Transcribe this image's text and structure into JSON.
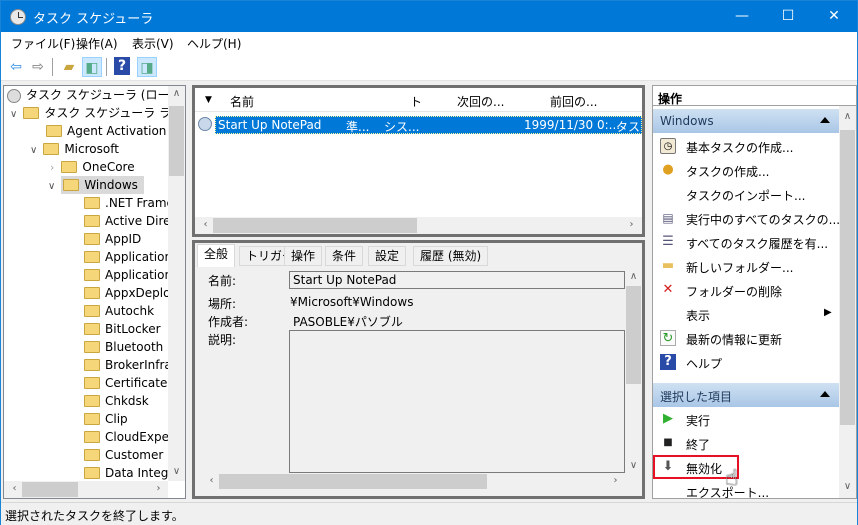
{
  "window": {
    "title": "タスク スケジューラ",
    "minimize": "—",
    "maximize": "☐",
    "close": "✕"
  },
  "menu": [
    "ファイル(F)",
    "操作(A)",
    "表示(V)",
    "ヘルプ(H)"
  ],
  "toolbar": {
    "icons": [
      "back-arrow-icon",
      "forward-arrow-icon",
      "up-folder-icon",
      "show-hide-console-tree-icon",
      "help-icon",
      "show-hide-action-pane-icon"
    ]
  },
  "tree": {
    "items": [
      {
        "label": "タスク スケジューラ (ローカル)",
        "level": 0,
        "chev": ""
      },
      {
        "label": "タスク スケジューラ ライブラリ",
        "level": 1,
        "chev": "∨"
      },
      {
        "label": "Agent Activation Runtime",
        "level": 2,
        "chev": ""
      },
      {
        "label": "Microsoft",
        "level": 2,
        "chev": "∨"
      },
      {
        "label": "OneCore",
        "level": 3,
        "chev": "›"
      },
      {
        "label": "Windows",
        "level": 3,
        "chev": "∨",
        "selected": true
      },
      {
        "label": ".NET Framework",
        "level": 4
      },
      {
        "label": "Active Directory",
        "level": 4
      },
      {
        "label": "AppID",
        "level": 4
      },
      {
        "label": "Application",
        "level": 4
      },
      {
        "label": "Application",
        "level": 4
      },
      {
        "label": "AppxDeployment",
        "level": 4
      },
      {
        "label": "Autochk",
        "level": 4
      },
      {
        "label": "BitLocker",
        "level": 4
      },
      {
        "label": "Bluetooth",
        "level": 4
      },
      {
        "label": "BrokerInfrastructure",
        "level": 4
      },
      {
        "label": "CertificateServices",
        "level": 4
      },
      {
        "label": "Chkdsk",
        "level": 4
      },
      {
        "label": "Clip",
        "level": 4
      },
      {
        "label": "CloudExperience",
        "level": 4
      },
      {
        "label": "Customer Experience",
        "level": 4
      },
      {
        "label": "Data Integrity",
        "level": 4
      }
    ]
  },
  "list": {
    "columns": [
      "名前",
      "ト",
      "次回の...",
      "前回の..."
    ],
    "rows": [
      {
        "name": "Start Up NotePad",
        "status": "準...",
        "trigger": "シス...",
        "last_run": "1999/11/30 0:...",
        "result": "タスク"
      }
    ]
  },
  "detail": {
    "tabs": [
      "全般",
      "トリガー",
      "操作",
      "条件",
      "設定",
      "履歴 (無効)"
    ],
    "name_label": "名前:",
    "name_value": "Start Up NotePad",
    "location_label": "場所:",
    "location_value": "¥Microsoft¥Windows",
    "author_label": "作成者:",
    "author_value": "PASOBLE¥パソブル",
    "desc_label": "説明:",
    "desc_value": ""
  },
  "actions": {
    "header": "操作",
    "group1": "Windows",
    "group1_items": [
      "基本タスクの作成...",
      "タスクの作成...",
      "タスクのインポート...",
      "実行中のすべてのタスクの...",
      "すべてのタスク履歴を有...",
      "新しいフォルダー...",
      "フォルダーの削除",
      "表示",
      "最新の情報に更新",
      "ヘルプ"
    ],
    "group2": "選択した項目",
    "group2_items": [
      "実行",
      "終了",
      "無効化",
      "エクスポート..."
    ],
    "highlight_color": "#e81123"
  },
  "status": "選択されたタスクを終了します。"
}
